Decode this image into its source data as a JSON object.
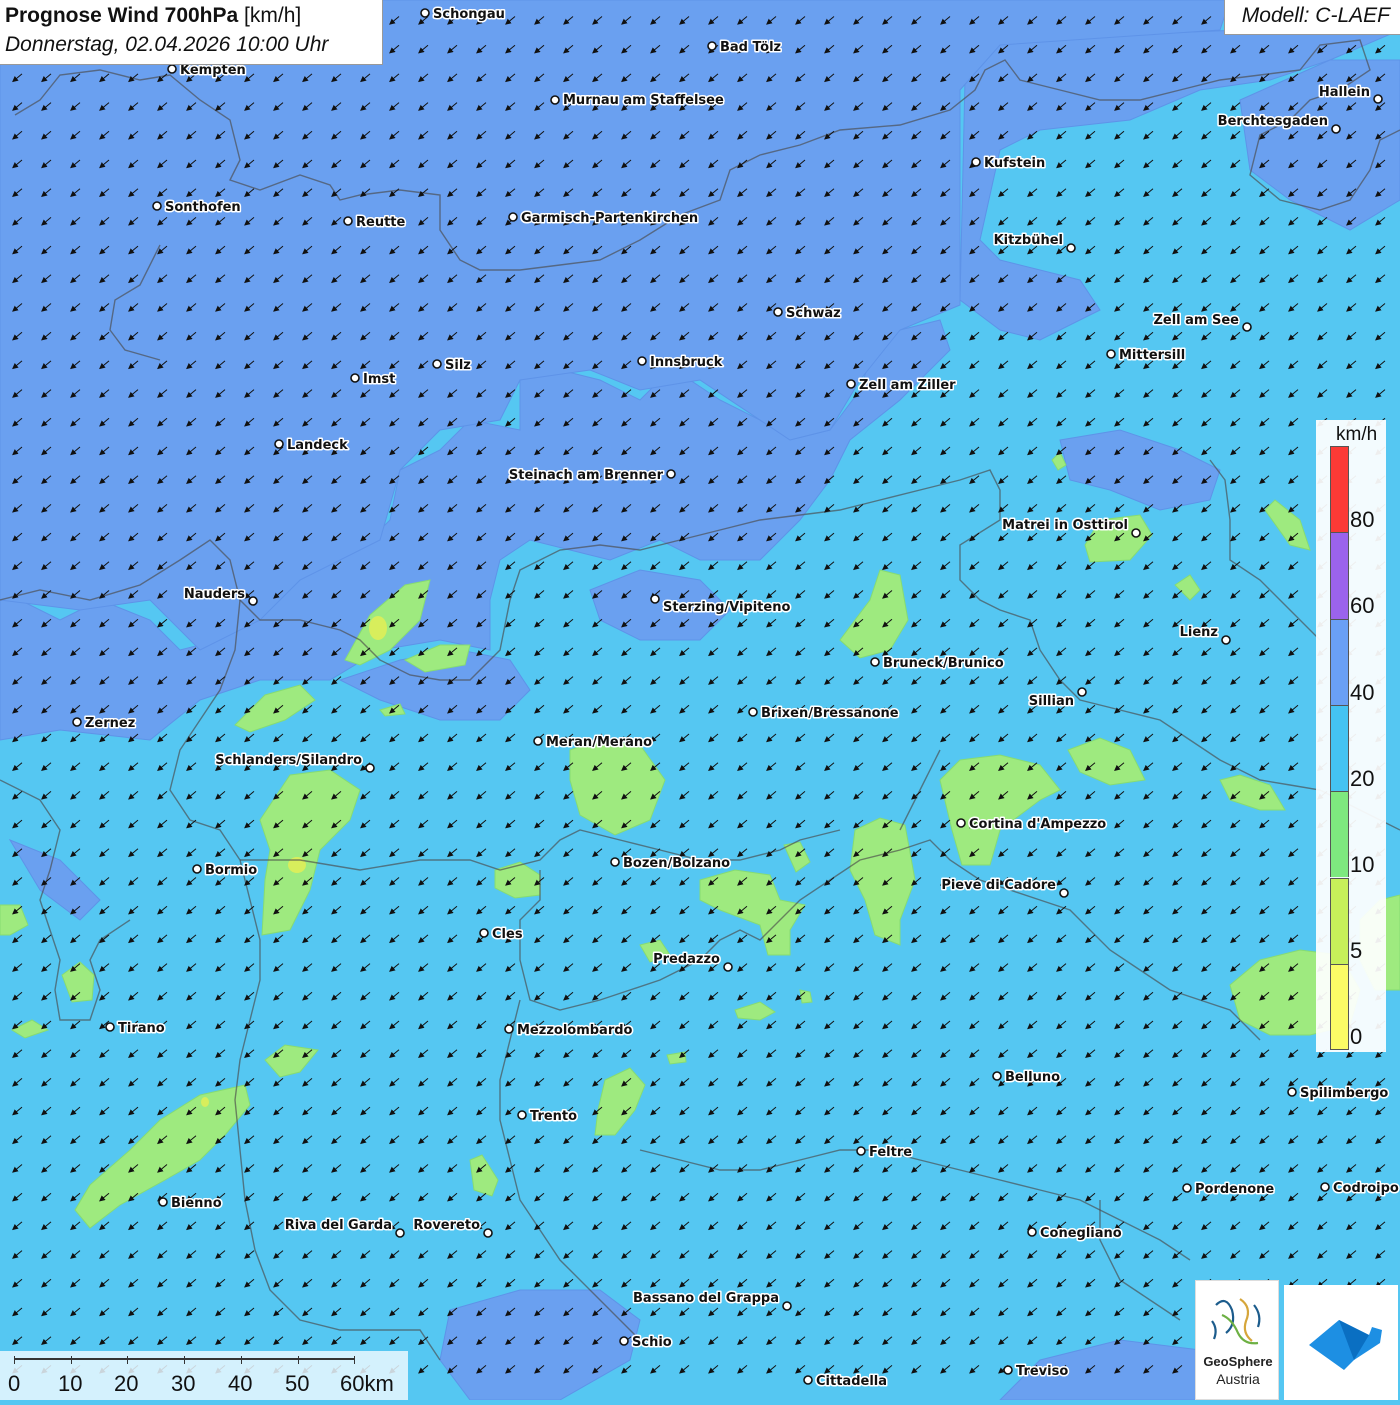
{
  "header": {
    "title_bold": "Prognose Wind 700hPa",
    "title_unit": "[km/h]",
    "datetime": "Donnerstag, 02.04.2026 10:00 Uhr",
    "model": "Modell: C-LAEF"
  },
  "legend": {
    "unit": "km/h",
    "ticks": [
      "80",
      "60",
      "40",
      "20",
      "10",
      "5",
      "0"
    ],
    "colors": [
      "#fb3a36",
      "#9b63ec",
      "#6aa0f5",
      "#44c3f2",
      "#7ee87f",
      "#c7f05a",
      "#fbfb66"
    ]
  },
  "scale": {
    "ticks": [
      "0",
      "10",
      "20",
      "30",
      "40",
      "50",
      "60km"
    ]
  },
  "logos": {
    "geosphere_line1": "GeoSphere",
    "geosphere_line2": "Austria"
  },
  "wind": {
    "direction": "northeast-to-southwest",
    "arrow_icon": "arrow-southwest-icon"
  },
  "cities": [
    {
      "name": "Schongau"
    },
    {
      "name": "Bad Tölz"
    },
    {
      "name": "Kempten"
    },
    {
      "name": "Murnau am Staffelsee"
    },
    {
      "name": "Hallein"
    },
    {
      "name": "Berchtesgaden"
    },
    {
      "name": "Kufstein"
    },
    {
      "name": "Sonthofen"
    },
    {
      "name": "Reutte"
    },
    {
      "name": "Garmisch-Partenkirchen"
    },
    {
      "name": "Kitzbühel"
    },
    {
      "name": "Schwaz"
    },
    {
      "name": "Zell am See"
    },
    {
      "name": "Mittersill"
    },
    {
      "name": "Innsbruck"
    },
    {
      "name": "Silz"
    },
    {
      "name": "Imst"
    },
    {
      "name": "Zell am Ziller"
    },
    {
      "name": "Landeck"
    },
    {
      "name": "Steinach am Brenner"
    },
    {
      "name": "Matrei in Osttirol"
    },
    {
      "name": "Nauders"
    },
    {
      "name": "Sterzing/Vipiteno"
    },
    {
      "name": "Lienz"
    },
    {
      "name": "Bruneck/Brunico"
    },
    {
      "name": "Sillian"
    },
    {
      "name": "Brixen/Bressanone"
    },
    {
      "name": "Zernez"
    },
    {
      "name": "Meran/Merano"
    },
    {
      "name": "Schlanders/Silandro"
    },
    {
      "name": "Cortina d'Ampezzo"
    },
    {
      "name": "Bozen/Bolzano"
    },
    {
      "name": "Bormio"
    },
    {
      "name": "Pieve di Cadore"
    },
    {
      "name": "Cles"
    },
    {
      "name": "Predazzo"
    },
    {
      "name": "Tirano"
    },
    {
      "name": "Mezzolombardo"
    },
    {
      "name": "Belluno"
    },
    {
      "name": "Spilimbergo"
    },
    {
      "name": "Trento"
    },
    {
      "name": "Feltre"
    },
    {
      "name": "Pordenone"
    },
    {
      "name": "Codroipo"
    },
    {
      "name": "Bienno"
    },
    {
      "name": "Riva del Garda"
    },
    {
      "name": "Rovereto"
    },
    {
      "name": "Conegliano"
    },
    {
      "name": "Bassano del Grappa"
    },
    {
      "name": "Schio"
    },
    {
      "name": "Treviso"
    },
    {
      "name": "Cittadella"
    }
  ]
}
